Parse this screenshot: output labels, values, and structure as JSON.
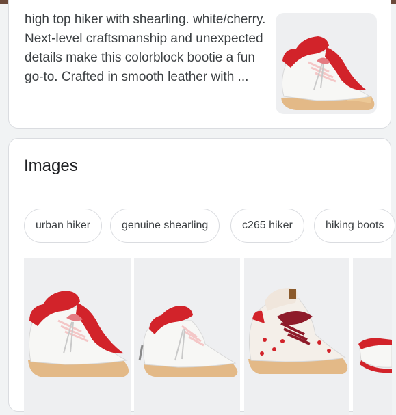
{
  "result": {
    "snippet": "high top hiker with shearling. white/cherry. Next-level craftsmanship and unexpected details make this colorblock bootie a fun go-to. Crafted in smooth leather with ..."
  },
  "images_section": {
    "heading": "Images",
    "chips": [
      {
        "label": "urban hiker"
      },
      {
        "label": "genuine shearling"
      },
      {
        "label": "c265 hiker"
      },
      {
        "label": "hiking boots"
      }
    ]
  },
  "colors": {
    "accent_red": "#d2232a",
    "sole_tan": "#e3b987",
    "leather_white": "#f7f7f5"
  }
}
